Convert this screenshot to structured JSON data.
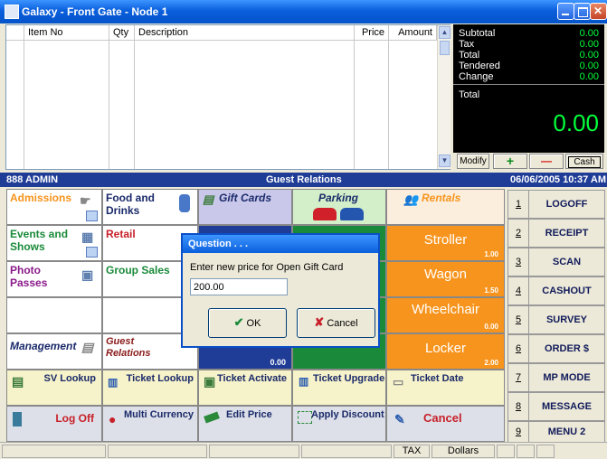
{
  "window": {
    "title": "Galaxy - Front Gate - Node 1"
  },
  "grid": {
    "columns": [
      "Item No",
      "Qty",
      "Description",
      "Price",
      "Amount"
    ]
  },
  "totals": {
    "rows": [
      {
        "label": "Subtotal",
        "value": "0.00"
      },
      {
        "label": "Tax",
        "value": "0.00"
      },
      {
        "label": "Total",
        "value": "0.00"
      },
      {
        "label": "Tendered",
        "value": "0.00"
      },
      {
        "label": "Change",
        "value": "0.00"
      }
    ],
    "total_label": "Total",
    "big_total": "0.00"
  },
  "controls": {
    "modify": "Modify",
    "plus": "+",
    "minus": "—",
    "cash": "Cash"
  },
  "header": {
    "user": "888 ADMIN",
    "center": "Guest Relations",
    "datetime": "06/06/2005 10:37 AM"
  },
  "categories": {
    "admissions": "Admissions",
    "food": "Food and Drinks",
    "gift_cards": "Gift Cards",
    "parking": "Parking",
    "rentals": "Rentals",
    "events": "Events and Shows",
    "retail": "Retail",
    "photo": "Photo Passes",
    "group": "Group Sales",
    "management": "Management",
    "guest_rel": "Guest Relations"
  },
  "rentals": [
    {
      "label": "Stroller",
      "price": "1.00"
    },
    {
      "label": "Wagon",
      "price": "1.50"
    },
    {
      "label": "Wheelchair",
      "price": "0.00"
    },
    {
      "label": "Locker",
      "price": "2.00"
    }
  ],
  "hidden_price": "0.00",
  "actions": {
    "sv_lookup": "SV Lookup",
    "ticket_lookup": "Ticket Lookup",
    "ticket_activate": "Ticket Activate",
    "ticket_upgrade": "Ticket Upgrade",
    "ticket_date": "Ticket Date",
    "log_off": "Log Off",
    "multi_currency": "Multi Currency",
    "edit_price": "Edit Price",
    "apply_discount": "Apply Discount",
    "cancel": "Cancel"
  },
  "side_menu": [
    {
      "num": "1",
      "label": "LOGOFF"
    },
    {
      "num": "2",
      "label": "RECEIPT"
    },
    {
      "num": "3",
      "label": "SCAN"
    },
    {
      "num": "4",
      "label": "CASHOUT"
    },
    {
      "num": "5",
      "label": "SURVEY"
    },
    {
      "num": "6",
      "label": "ORDER $"
    },
    {
      "num": "7",
      "label": "MP MODE"
    },
    {
      "num": "8",
      "label": "MESSAGE"
    },
    {
      "num": "9",
      "label": "MENU 2"
    }
  ],
  "dialog": {
    "title": "Question . . .",
    "prompt": "Enter new price for Open Gift Card",
    "value": "200.00",
    "ok": "OK",
    "cancel": "Cancel"
  },
  "status": {
    "tax": "TAX",
    "currency": "Dollars"
  },
  "colors": {
    "orange": "#f7941d",
    "green": "#1a8a3a",
    "navy": "#1f3c96",
    "lcd_green": "#00ff3c"
  }
}
